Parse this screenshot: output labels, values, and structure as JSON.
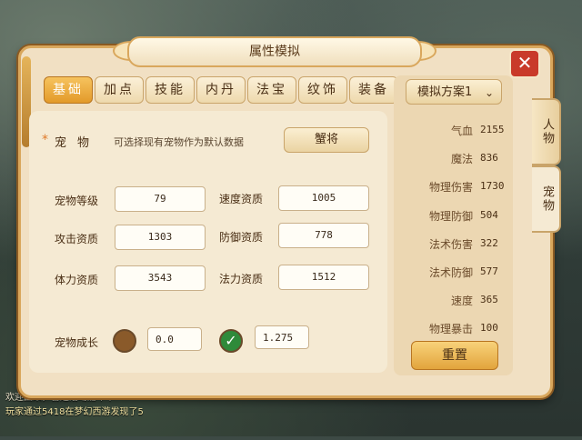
{
  "window": {
    "title": "属性模拟",
    "close_label": "✕"
  },
  "tabs": [
    "基础",
    "加点",
    "技能",
    "内丹",
    "法宝",
    "纹饰",
    "装备"
  ],
  "active_tab_index": 0,
  "pet": {
    "label": "宠物",
    "hint": "可选择现有宠物作为默认数据",
    "button": "蟹将"
  },
  "fields": {
    "level": {
      "label": "宠物等级",
      "value": "79"
    },
    "attack": {
      "label": "攻击资质",
      "value": "1303"
    },
    "stamina": {
      "label": "体力资质",
      "value": "3543"
    },
    "speed": {
      "label": "速度资质",
      "value": "1005"
    },
    "defense": {
      "label": "防御资质",
      "value": "778"
    },
    "mana": {
      "label": "法力资质",
      "value": "1512"
    }
  },
  "growth": {
    "label": "宠物成长",
    "value1": "0.0",
    "value2": "1.275"
  },
  "scheme": {
    "label": "模拟方案1",
    "chevron": "⌄"
  },
  "stats": [
    {
      "name": "气血",
      "value": "2155"
    },
    {
      "name": "魔法",
      "value": "836"
    },
    {
      "name": "物理伤害",
      "value": "1730"
    },
    {
      "name": "物理防御",
      "value": "504"
    },
    {
      "name": "法术伤害",
      "value": "322"
    },
    {
      "name": "法术防御",
      "value": "577"
    },
    {
      "name": "速度",
      "value": "365"
    },
    {
      "name": "物理暴击",
      "value": "100"
    }
  ],
  "reset_label": "重置",
  "side_tabs": [
    "人物",
    "宠物"
  ],
  "chat": [
    "欢迎回来，喜迎活动嘉年华",
    "玩家通过5418在梦幻西游发现了5"
  ],
  "colors": {
    "accent": "#e39a2a",
    "panel": "#f1e0c3",
    "close": "#c93a2a"
  }
}
